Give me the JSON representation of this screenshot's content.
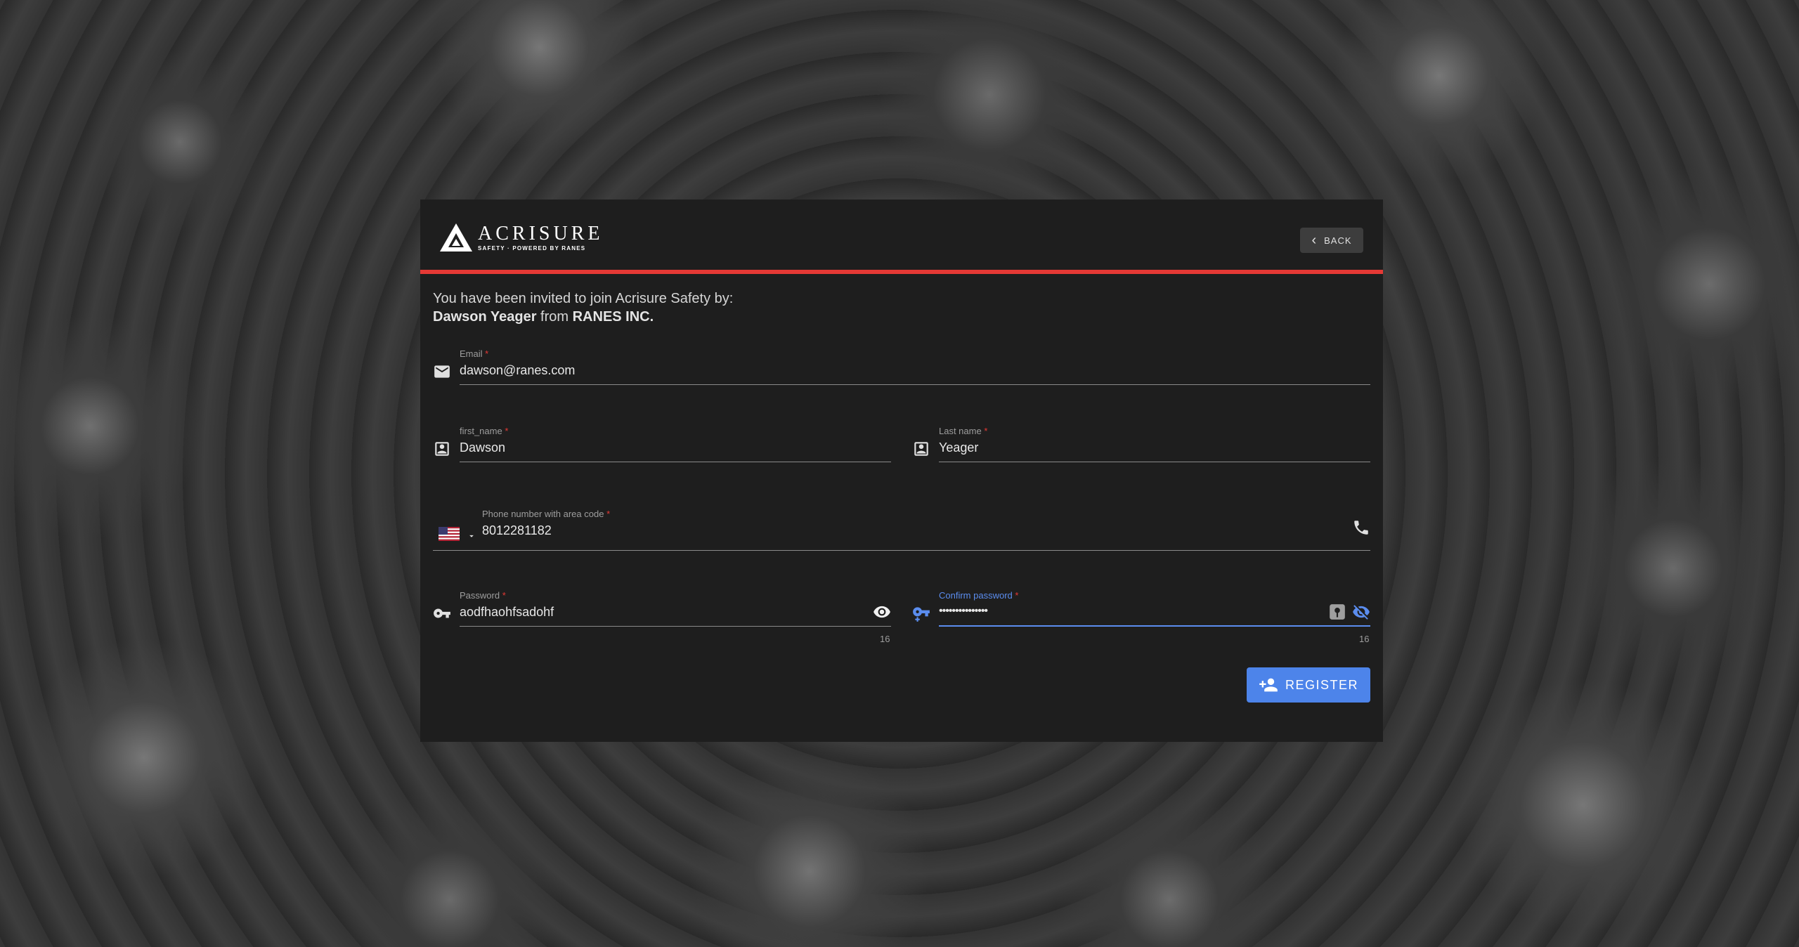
{
  "header": {
    "logo_name": "ACRISURE",
    "logo_tagline": "SAFETY · POWERED BY RANES",
    "back_label": "BACK"
  },
  "invite": {
    "line1": "You have been invited to join Acrisure Safety by:",
    "inviter_name": "Dawson Yeager",
    "from_word": "from",
    "company": "RANES INC."
  },
  "form": {
    "email": {
      "label": "Email",
      "required": "*",
      "value": "dawson@ranes.com"
    },
    "first_name": {
      "label": "first_name",
      "required": "*",
      "value": "Dawson"
    },
    "last_name": {
      "label": "Last name",
      "required": "*",
      "value": "Yeager"
    },
    "phone": {
      "label": "Phone number with area code",
      "required": "*",
      "value": "8012281182",
      "country": "US"
    },
    "password": {
      "label": "Password",
      "required": "*",
      "value": "aodfhaohfsadohf",
      "counter": "16"
    },
    "confirm_password": {
      "label": "Confirm password",
      "required": "*",
      "value": "•••••••••••••••",
      "counter": "16"
    },
    "register_label": "REGISTER"
  },
  "colors": {
    "accent": "#4d84ea",
    "brand_red": "#e53935",
    "card_bg": "#1e1e1e"
  }
}
